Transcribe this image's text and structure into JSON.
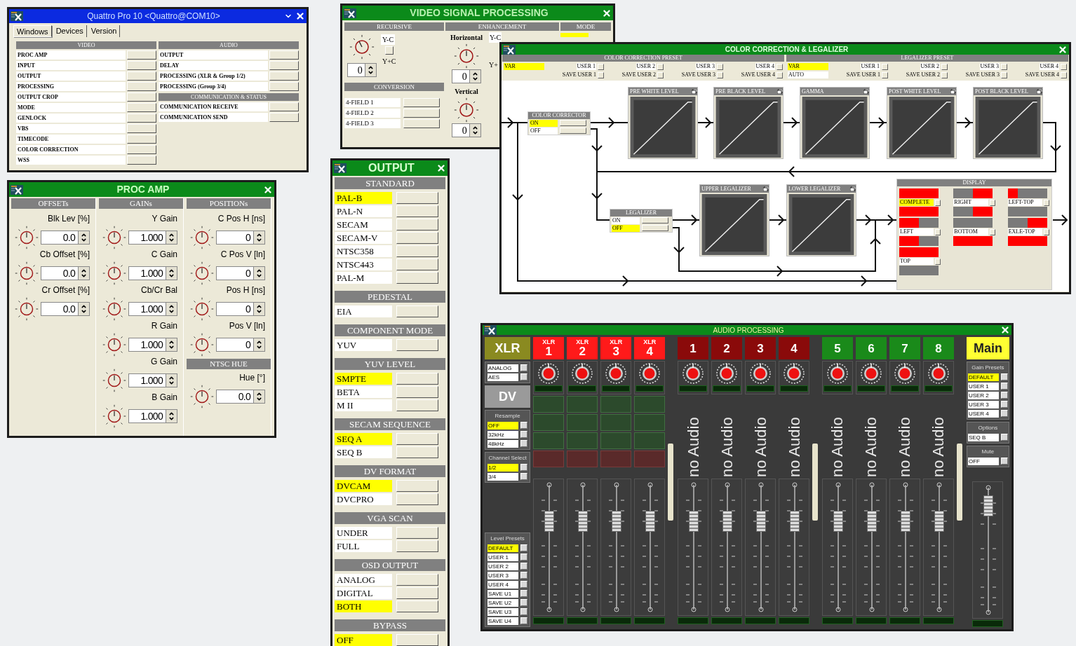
{
  "quattro": {
    "title": "Quattro Pro 10 <Quattro@COM10>",
    "tabs": [
      {
        "label": "Windows",
        "selected": true
      },
      {
        "label": "Devices",
        "selected": false
      },
      {
        "label": "Version",
        "selected": false
      }
    ],
    "video": {
      "header": "VIDEO",
      "items": [
        "PROC AMP",
        "INPUT",
        "OUTPUT",
        "PROCESSING",
        "OUTPUT CROP",
        "MODE",
        "GENLOCK",
        "VBS",
        "TIMECODE",
        "COLOR CORRECTION",
        "WSS"
      ]
    },
    "audio": {
      "header": "AUDIO",
      "items": [
        "OUTPUT",
        "DELAY",
        "PROCESSING (XLR & Group 1/2)",
        "PROCESSING (Group 3/4)"
      ]
    },
    "comm": {
      "header": "COMMUNICATION & STATUS",
      "items": [
        "COMMUNICATION RECEIVE",
        "COMMUNICATION SEND"
      ]
    }
  },
  "vsp": {
    "title": "VIDEO SIGNAL PROCESSING",
    "recursive": {
      "header": "RECURSIVE",
      "top": "Y-C",
      "bottom": "Y+C",
      "value": "0"
    },
    "conversion": {
      "header": "CONVERSION",
      "items": [
        "4-FIELD 1",
        "4-FIELD 2",
        "4-FIELD 3"
      ]
    },
    "enhancement": {
      "header": "ENHANCEMENT",
      "horizontal": "Horizontal",
      "h_value": "0",
      "h_top": "Y-C",
      "h_mode": "Y+",
      "vertical": "Vertical",
      "v_value": "0"
    },
    "mode": {
      "header": "MODE",
      "selected": true
    }
  },
  "proc": {
    "title": "PROC AMP",
    "columns": [
      {
        "header": "OFFSETs",
        "items": [
          {
            "label": "Blk Lev [%]",
            "value": "0.0"
          },
          {
            "label": "Cb Offset [%]",
            "value": "0.0"
          },
          {
            "label": "Cr Offset [%]",
            "value": "0.0"
          }
        ]
      },
      {
        "header": "GAINs",
        "items": [
          {
            "label": "Y Gain",
            "value": "1.000"
          },
          {
            "label": "C Gain",
            "value": "1.000"
          },
          {
            "label": "Cb/Cr Bal",
            "value": "1.000"
          },
          {
            "label": "R Gain",
            "value": "1.000"
          },
          {
            "label": "G Gain",
            "value": "1.000"
          },
          {
            "label": "B Gain",
            "value": "1.000"
          }
        ]
      },
      {
        "header": "POSITIONs",
        "items": [
          {
            "label": "C Pos H [ns]",
            "value": "0"
          },
          {
            "label": "C Pos V [ln]",
            "value": "0"
          },
          {
            "label": "Pos H [ns]",
            "value": "0"
          },
          {
            "label": "Pos V [ln]",
            "value": "0"
          }
        ]
      }
    ],
    "hue": {
      "header": "NTSC HUE",
      "items": [
        {
          "label": "Hue [°]",
          "value": "0.0"
        }
      ]
    }
  },
  "output": {
    "title": "OUTPUT",
    "sections": [
      {
        "header": "STANDARD",
        "options": [
          {
            "label": "PAL-B",
            "selected": true
          },
          {
            "label": "PAL-N",
            "selected": false
          },
          {
            "label": "SECAM",
            "selected": false
          },
          {
            "label": "SECAM-V",
            "selected": false
          },
          {
            "label": "NTSC358",
            "selected": false
          },
          {
            "label": "NTSC443",
            "selected": false
          },
          {
            "label": "PAL-M",
            "selected": false
          }
        ]
      },
      {
        "header": "PEDESTAL",
        "options": [
          {
            "label": "EIA",
            "selected": false
          }
        ]
      },
      {
        "header": "COMPONENT MODE",
        "options": [
          {
            "label": "YUV",
            "selected": false
          }
        ]
      },
      {
        "header": "YUV LEVEL",
        "options": [
          {
            "label": "SMPTE",
            "selected": true
          },
          {
            "label": "BETA",
            "selected": false
          },
          {
            "label": "M II",
            "selected": false
          }
        ]
      },
      {
        "header": "SECAM SEQUENCE",
        "options": [
          {
            "label": "SEQ A",
            "selected": true
          },
          {
            "label": "SEQ B",
            "selected": false
          }
        ]
      },
      {
        "header": "DV FORMAT",
        "options": [
          {
            "label": "DVCAM",
            "selected": true
          },
          {
            "label": "DVCPRO",
            "selected": false
          }
        ]
      },
      {
        "header": "VGA SCAN",
        "options": [
          {
            "label": "UNDER",
            "selected": false
          },
          {
            "label": "FULL",
            "selected": false
          }
        ]
      },
      {
        "header": "OSD OUTPUT",
        "options": [
          {
            "label": "ANALOG",
            "selected": false
          },
          {
            "label": "DIGITAL",
            "selected": false
          },
          {
            "label": "BOTH",
            "selected": true
          }
        ]
      },
      {
        "header": "BYPASS",
        "options": [
          {
            "label": "OFF",
            "selected": true
          }
        ]
      }
    ]
  },
  "cc": {
    "title": "COLOR CORRECTION & LEGALIZER",
    "presets": [
      {
        "header": "COLOR CORRECTION PRESET",
        "modes": [
          {
            "label": "VAR",
            "selected": true
          }
        ],
        "users": [
          "USER 1",
          "USER 2",
          "USER 3",
          "USER 4"
        ],
        "saves": [
          "SAVE USER 1",
          "SAVE USER 2",
          "SAVE USER 3",
          "SAVE USER 4"
        ]
      },
      {
        "header": "LEGALIZER PRESET",
        "modes": [
          {
            "label": "VAR",
            "selected": true
          },
          {
            "label": "AUTO",
            "selected": false
          }
        ],
        "users": [
          "USER 1",
          "USER 2",
          "USER 3",
          "USER 4"
        ],
        "saves": [
          "SAVE USER 1",
          "SAVE USER 2",
          "SAVE USER 3",
          "SAVE USER 4"
        ]
      }
    ],
    "corrector": {
      "header": "COLOR CORRECTOR",
      "options": [
        {
          "label": "ON",
          "selected": true
        },
        {
          "label": "OFF",
          "selected": false
        }
      ]
    },
    "curves": [
      "PRE WHITE LEVEL",
      "PRE BLACK LEVEL",
      "GAMMA",
      "POST WHITE LEVEL",
      "POST BLACK LEVEL"
    ],
    "legalizer": {
      "header": "LEGALIZER",
      "options": [
        {
          "label": "ON",
          "selected": false
        },
        {
          "label": "OFF",
          "selected": true
        }
      ]
    },
    "legalizer_curves": [
      "UPPER LEGALIZER",
      "LOWER LEGALIZER"
    ],
    "display": {
      "header": "DISPLAY",
      "items": [
        {
          "label": "COMPLETE",
          "kind": "complete",
          "selected": true
        },
        {
          "label": "RIGHT",
          "kind": "right",
          "selected": false
        },
        {
          "label": "LEFT-TOP",
          "kind": "lefttop",
          "selected": false
        },
        {
          "label": "LEFT",
          "kind": "left",
          "selected": false
        },
        {
          "label": "BOTTOM",
          "kind": "bottom",
          "selected": false
        },
        {
          "label": "EXLE-TOP",
          "kind": "excltop",
          "selected": false
        },
        {
          "label": "TOP",
          "kind": "top",
          "selected": false
        }
      ]
    }
  },
  "audio": {
    "title": "AUDIO PROCESSING",
    "left": {
      "source": "XLR",
      "inputs": [
        {
          "label": "ANALOG",
          "selected": false
        },
        {
          "label": "AES",
          "selected": false
        }
      ],
      "dv": "DV",
      "groups": [
        {
          "header": "Resample",
          "options": [
            {
              "label": "OFF",
              "selected": true
            },
            {
              "label": "32kHz",
              "selected": false
            },
            {
              "label": "48kHz",
              "selected": false
            }
          ]
        },
        {
          "header": "Channel Select",
          "options": [
            {
              "label": "1/2",
              "selected": true
            },
            {
              "label": "3/4",
              "selected": false
            }
          ]
        }
      ],
      "presets": {
        "header": "Level Presets",
        "options": [
          {
            "label": "DEFAULT",
            "selected": true
          },
          {
            "label": "USER 1",
            "selected": false
          },
          {
            "label": "USER 2",
            "selected": false
          },
          {
            "label": "USER 3",
            "selected": false
          },
          {
            "label": "USER 4",
            "selected": false
          },
          {
            "label": "SAVE U1",
            "selected": false
          },
          {
            "label": "SAVE U2",
            "selected": false
          },
          {
            "label": "SAVE U3",
            "selected": false
          },
          {
            "label": "SAVE U4",
            "selected": false
          }
        ]
      }
    },
    "groups": [
      {
        "channels": [
          {
            "kind": "xlr",
            "label": "XLR",
            "number": "1",
            "color": "#ff1a1a",
            "level": 0.72
          },
          {
            "kind": "xlr",
            "label": "XLR",
            "number": "2",
            "color": "#ff1a1a",
            "level": 0.72
          },
          {
            "kind": "xlr",
            "label": "XLR",
            "number": "3",
            "color": "#ff1a1a",
            "level": 0.72
          },
          {
            "kind": "xlr",
            "label": "XLR",
            "number": "4",
            "color": "#ff1a1a",
            "level": 0.72
          }
        ]
      },
      {
        "channels": [
          {
            "kind": "channel",
            "number": "1",
            "color": "#8a0a0a",
            "status": "no Audio",
            "level": 0.72
          },
          {
            "kind": "channel",
            "number": "2",
            "color": "#8a0a0a",
            "status": "no Audio",
            "level": 0.72
          },
          {
            "kind": "channel",
            "number": "3",
            "color": "#8a0a0a",
            "status": "no Audio",
            "level": 0.72
          },
          {
            "kind": "channel",
            "number": "4",
            "color": "#8a0a0a",
            "status": "no Audio",
            "level": 0.72
          }
        ]
      },
      {
        "channels": [
          {
            "kind": "channel",
            "number": "5",
            "color": "#1a8a1a",
            "status": "no Audio",
            "level": 0.72
          },
          {
            "kind": "channel",
            "number": "6",
            "color": "#1a8a1a",
            "status": "no Audio",
            "level": 0.72
          },
          {
            "kind": "channel",
            "number": "7",
            "color": "#1a8a1a",
            "status": "no Audio",
            "level": 0.72
          },
          {
            "kind": "channel",
            "number": "8",
            "color": "#1a8a1a",
            "status": "no Audio",
            "level": 0.72
          }
        ]
      }
    ],
    "right": {
      "main": {
        "label": "Main",
        "level": 0.88
      },
      "gain": {
        "header": "Gain Presets",
        "options": [
          {
            "label": "DEFAULT",
            "selected": true
          },
          {
            "label": "USER 1",
            "selected": false
          },
          {
            "label": "USER 2",
            "selected": false
          },
          {
            "label": "USER 3",
            "selected": false
          },
          {
            "label": "USER 4",
            "selected": false
          }
        ]
      },
      "options": {
        "header": "Options",
        "options": [
          {
            "label": "SEQ B",
            "selected": false
          }
        ]
      },
      "mute": {
        "header": "Mute",
        "options": [
          {
            "label": "OFF",
            "selected": false
          }
        ]
      }
    }
  }
}
